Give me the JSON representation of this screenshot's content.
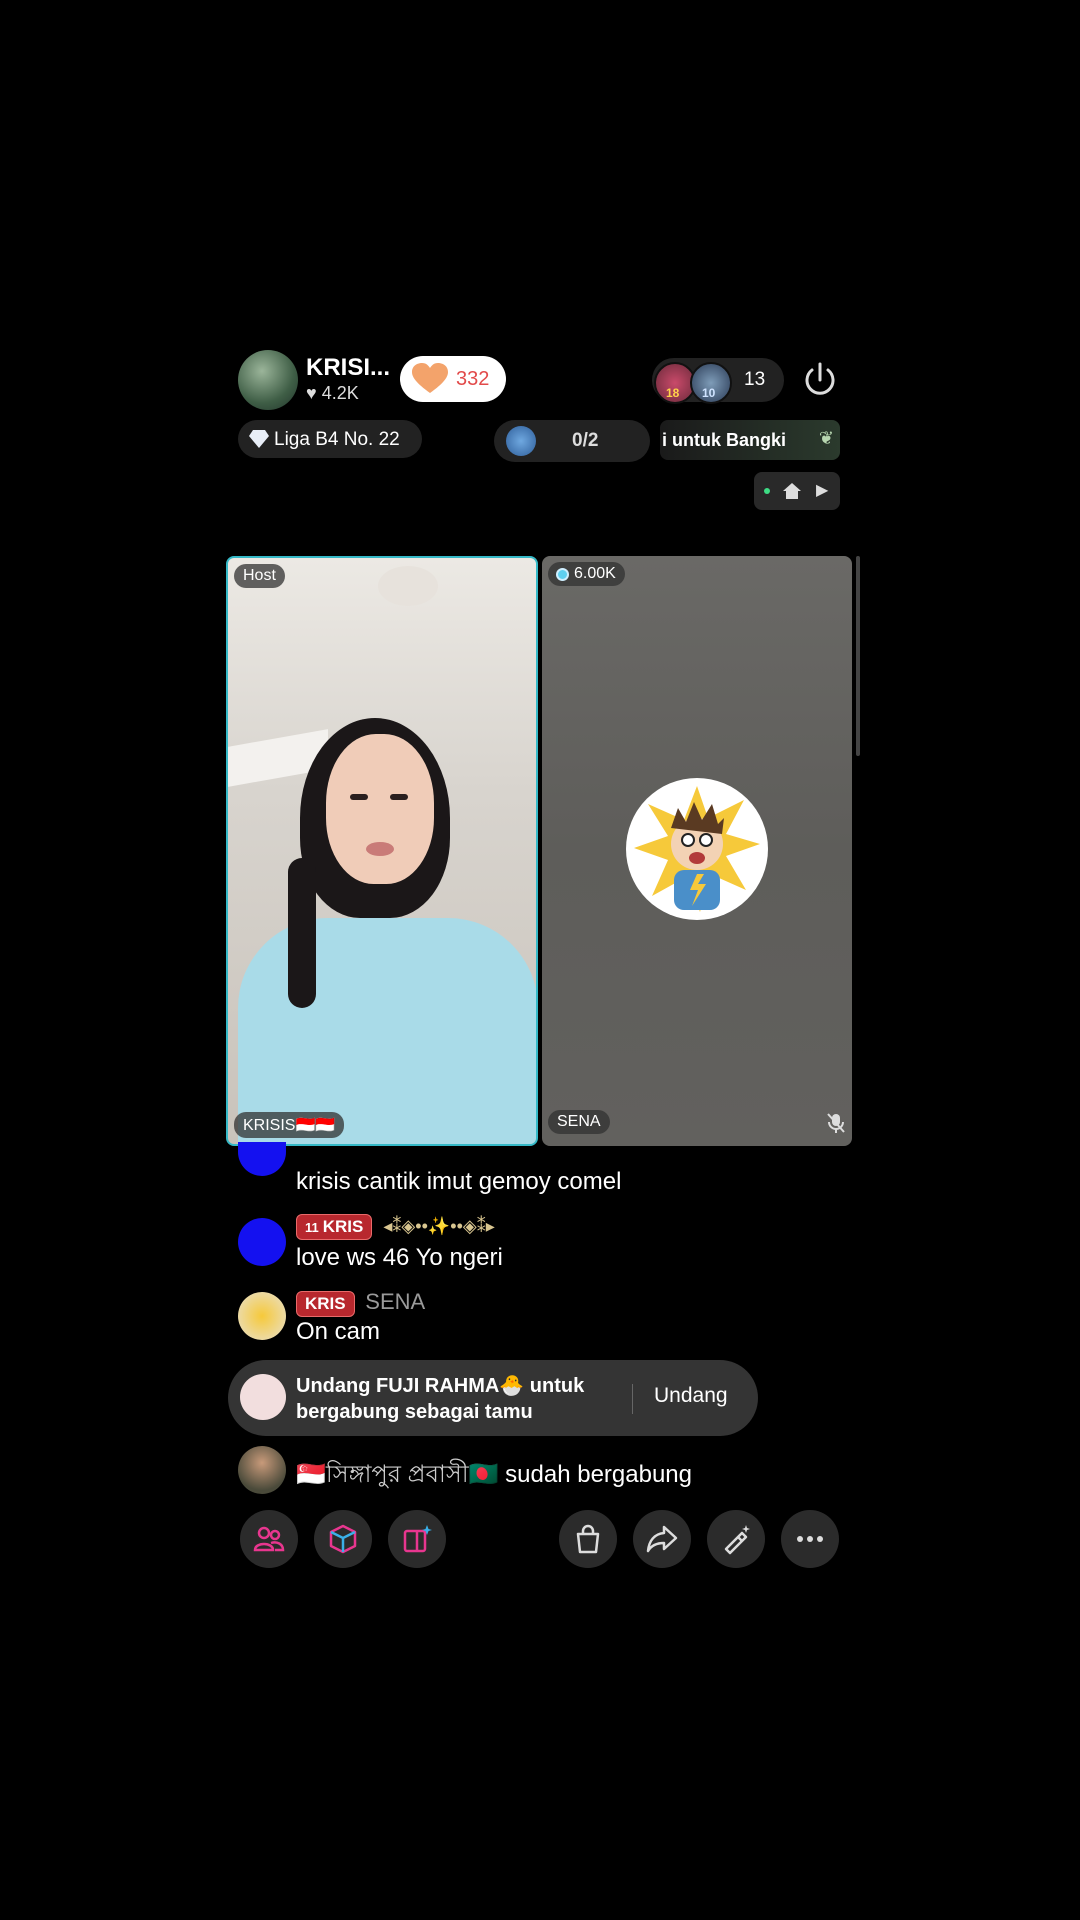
{
  "header": {
    "host_name": "KRISI...",
    "host_likes": "4.2K",
    "like_count": "332",
    "viewer_badges": [
      "18",
      "10"
    ],
    "viewer_count": "13"
  },
  "league": {
    "label": "Liga B4 No. 22"
  },
  "goal": {
    "progress": "0/2"
  },
  "ticker": {
    "text": "i untuk Bangki"
  },
  "panels": {
    "host": {
      "tag": "Host",
      "name": "KRISIS🇮🇩🇮🇩"
    },
    "guest": {
      "score": "6.00K",
      "name": "SENA"
    }
  },
  "chat": [
    {
      "text": "krisis cantik imut gemoy comel"
    },
    {
      "badge": "KRIS",
      "badge_level": "11",
      "decor": "◂⁑◈••✨••◈⁑▸",
      "text": "love ws 46 Yo ngeri"
    },
    {
      "badge": "KRIS",
      "name": "SENA",
      "text": "On cam"
    }
  ],
  "invite": {
    "text_line1": "Undang FUJI RAHMA🐣 untuk",
    "text_line2": "bergabung sebagai tamu",
    "button": "Undang"
  },
  "join": {
    "flag": "🇸🇬",
    "name": "সিঙ্গাপুর প্রবাসী",
    "flag2": "🇧🇩",
    "action": "sudah bergabung"
  },
  "colors": {
    "like": "#e24a4a",
    "host_border": "#35b9c7",
    "accent_pink": "#e8368f"
  }
}
